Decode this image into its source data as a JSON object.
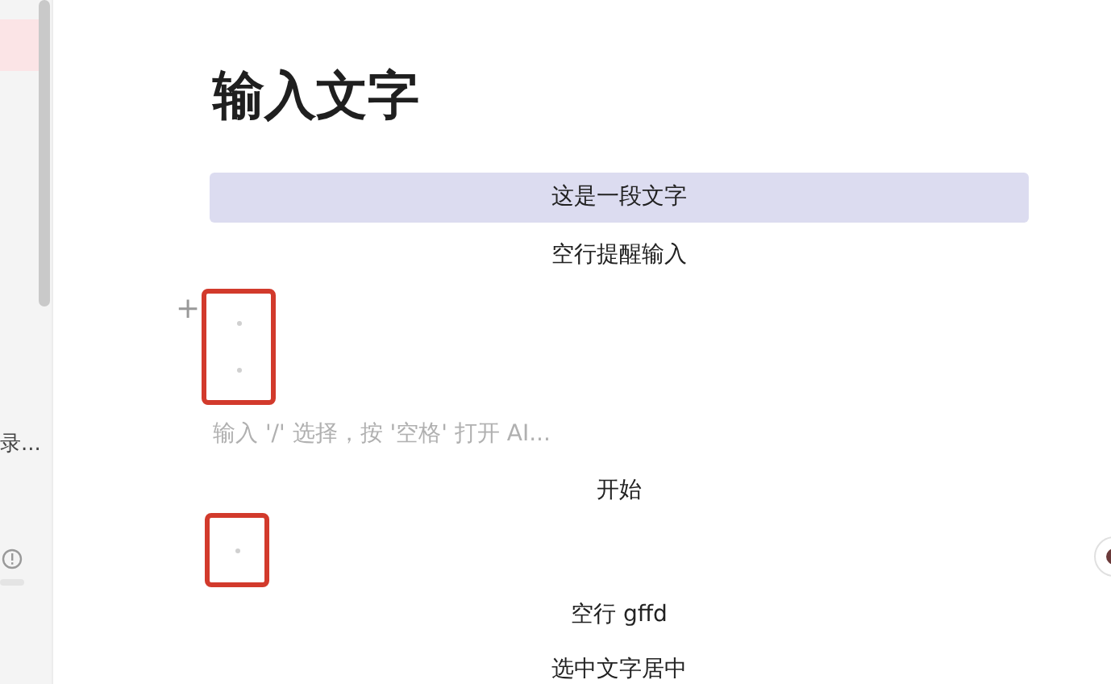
{
  "sidebar": {
    "items": [
      {
        "selected": true
      }
    ],
    "truncated_label": "录..."
  },
  "editor": {
    "blocks": [
      {
        "kind": "heading",
        "text": "输入文字"
      },
      {
        "kind": "paragraph",
        "text": "这是一段文字",
        "highlighted": true
      },
      {
        "kind": "paragraph",
        "text": "空行提醒输入",
        "highlighted": false
      },
      {
        "kind": "blank-group",
        "annotated": true,
        "handle": "+",
        "blanks": [
          {
            "kind": "blank"
          },
          {
            "kind": "blank"
          }
        ]
      },
      {
        "kind": "placeholder",
        "placeholder": "输入 '/' 选择，按 '空格' 打开 AI..."
      },
      {
        "kind": "paragraph",
        "text": "开始",
        "highlighted": false
      },
      {
        "kind": "blank-group",
        "annotated": true,
        "blanks": [
          {
            "kind": "blank"
          }
        ]
      },
      {
        "kind": "paragraph",
        "text": "空行 gffd",
        "highlighted": false
      },
      {
        "kind": "paragraph",
        "text": "选中文字居中",
        "highlighted": false
      }
    ]
  }
}
